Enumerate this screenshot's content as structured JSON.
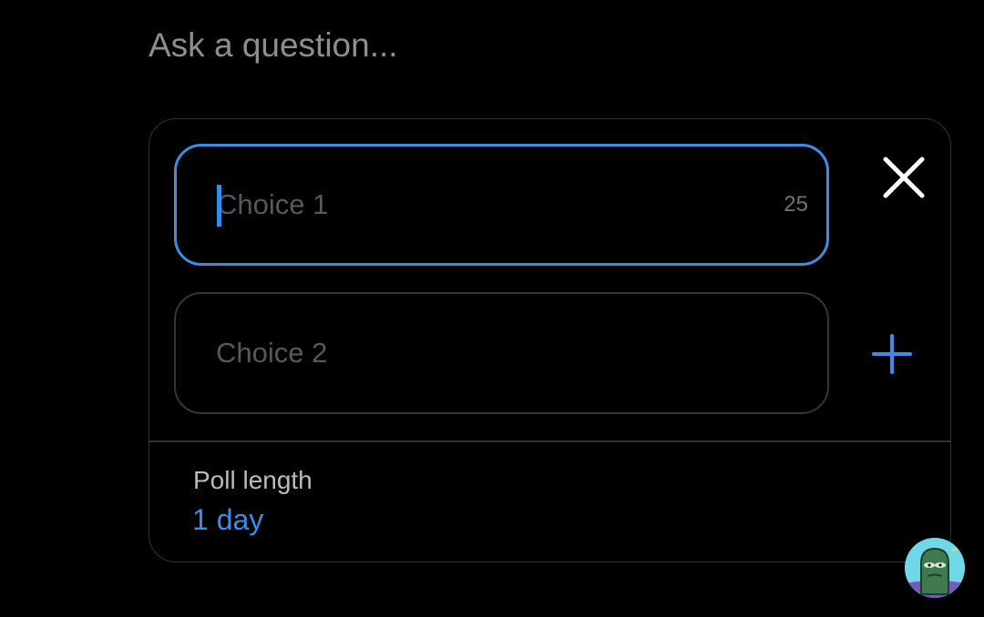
{
  "composer": {
    "question_placeholder": "Ask a question..."
  },
  "poll": {
    "choices": [
      {
        "placeholder": "Choice 1",
        "remaining_chars": "25",
        "focused": true
      },
      {
        "placeholder": "Choice 2",
        "focused": false
      }
    ],
    "remove_icon": "close-icon",
    "add_icon": "plus-icon",
    "length_label": "Poll length",
    "length_value": "1 day"
  },
  "colors": {
    "accent": "#3a8ee8",
    "background": "#000000",
    "border": "#2f3336",
    "placeholder": "#55595d"
  },
  "avatar": {
    "icon": "user-avatar"
  }
}
